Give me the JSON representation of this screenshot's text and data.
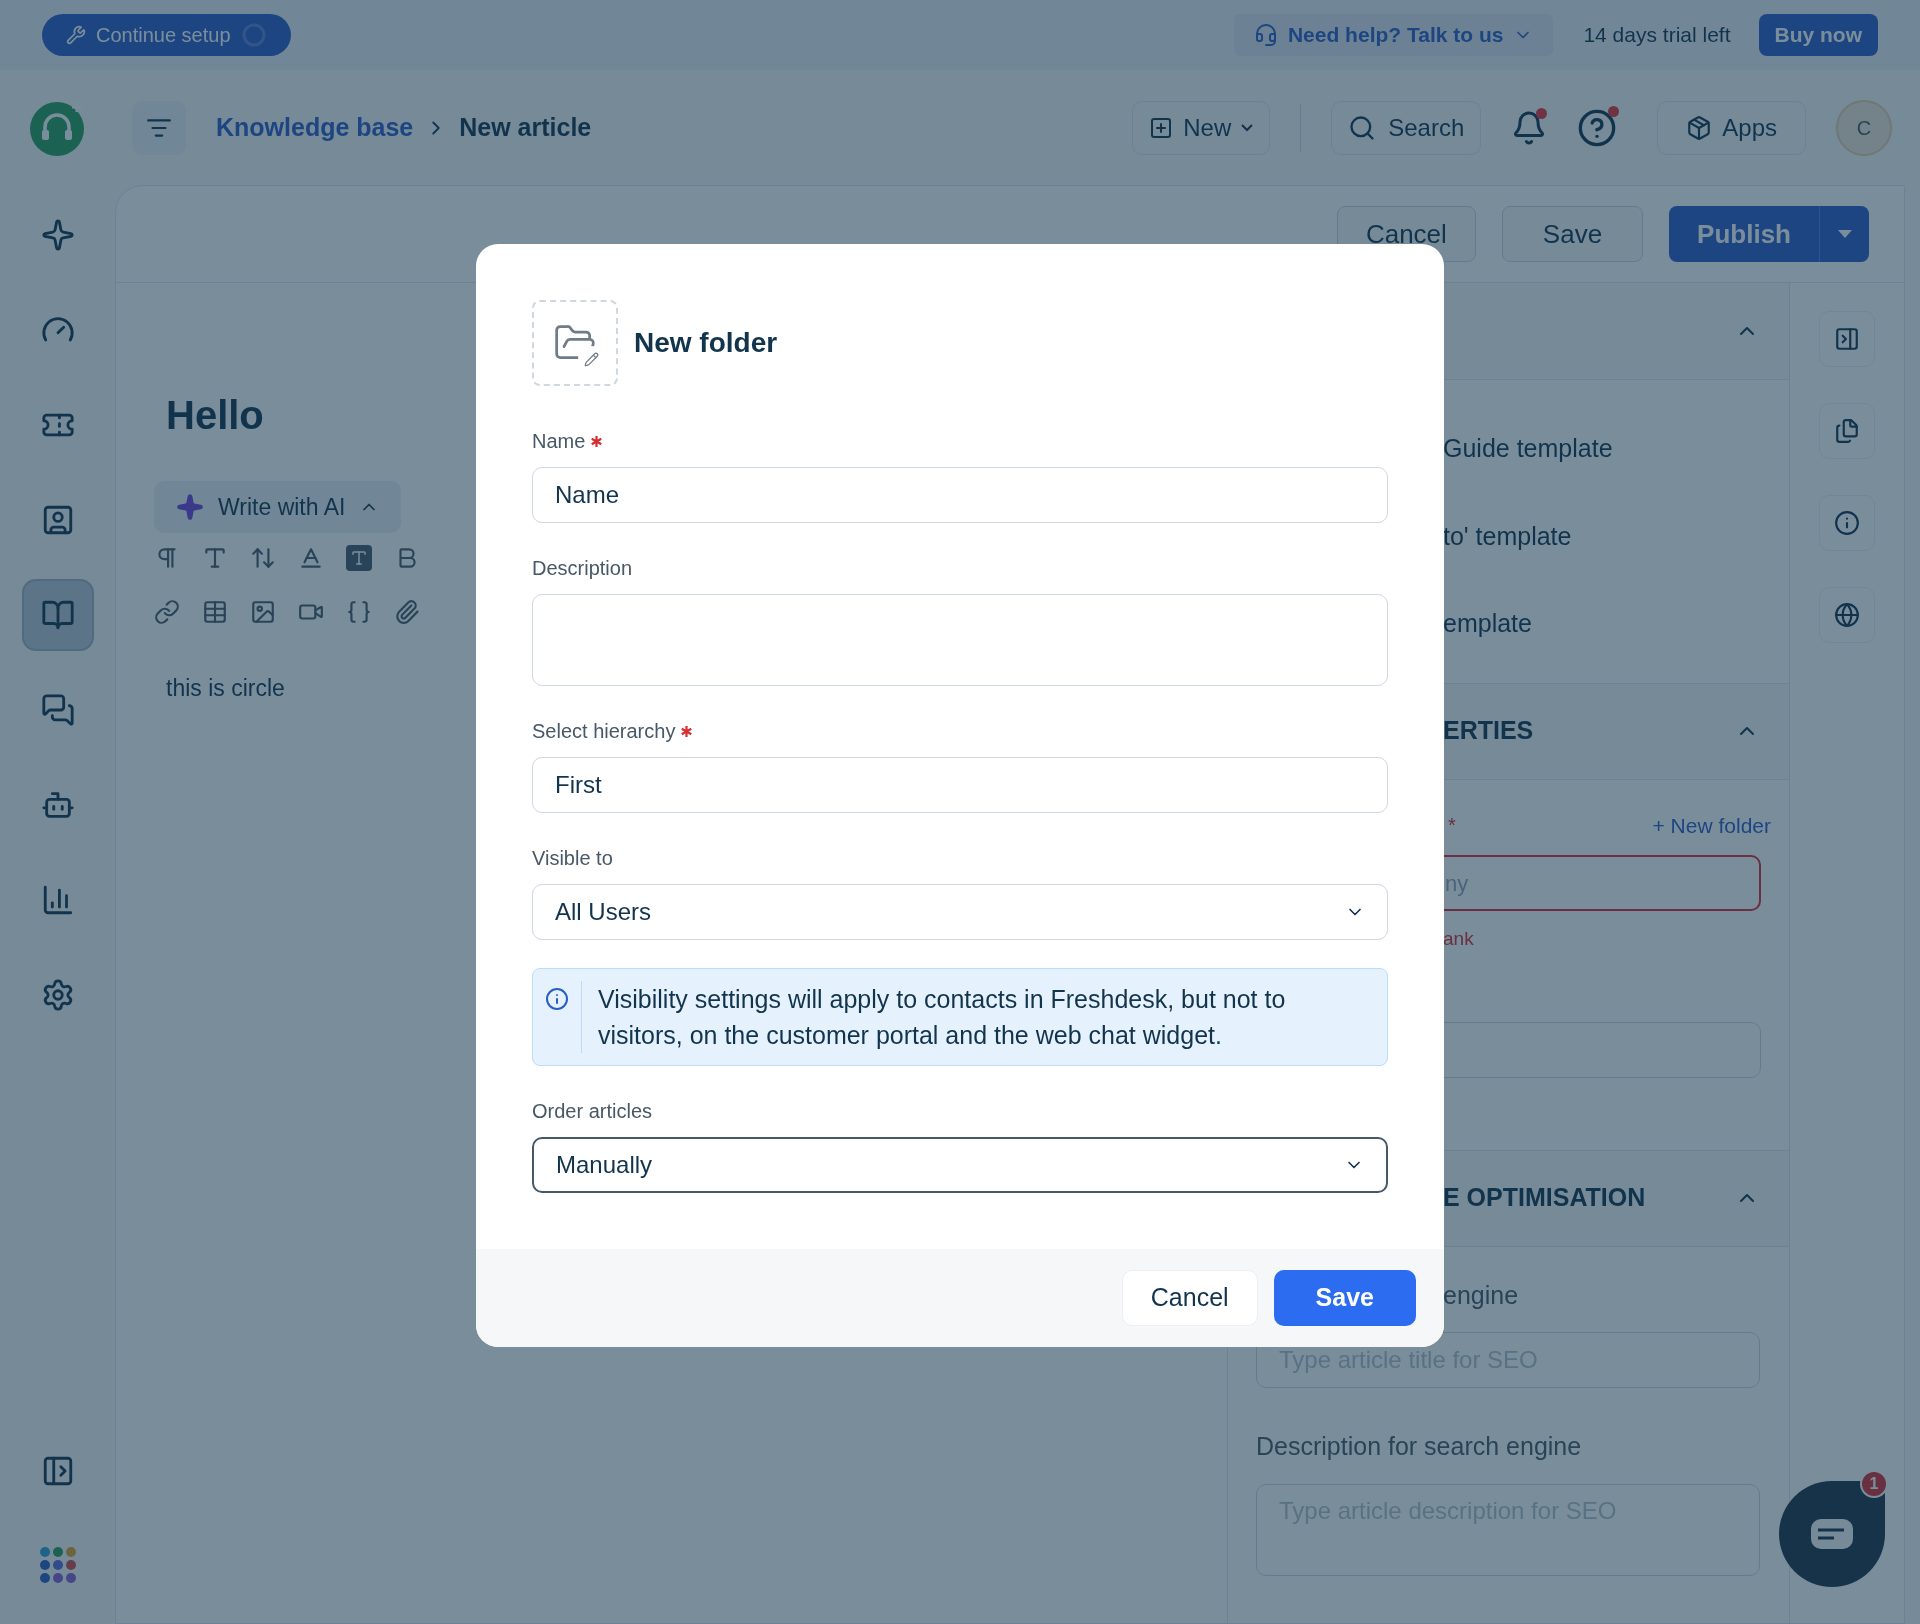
{
  "top_bar": {
    "setup_button": "Continue setup",
    "help_button": "Need help? Talk to us",
    "trial_text": "14 days trial left",
    "buy_button": "Buy now"
  },
  "header": {
    "breadcrumbs": [
      "Knowledge base",
      "New article"
    ],
    "new_button": "New",
    "search_button": "Search",
    "bell_dot": true,
    "help_dot": true,
    "apps_button": "Apps",
    "avatar": "C"
  },
  "sidebar": {
    "items": [
      {
        "selected": false
      },
      {
        "selected": false
      },
      {
        "selected": false
      },
      {
        "selected": false
      },
      {
        "selected": true
      },
      {
        "selected": false
      },
      {
        "selected": false
      },
      {
        "selected": false
      },
      {
        "selected": false
      }
    ]
  },
  "article_actions": {
    "cancel": "Cancel",
    "save": "Save",
    "publish": "Publish"
  },
  "editor": {
    "title": "Hello",
    "ai_button": "Write with AI",
    "body": "this is circle"
  },
  "right_panel": {
    "templates": [
      "Guide template",
      "to' template",
      "emplate"
    ],
    "properties": {
      "heading": "ERTIES",
      "required_mark": "*",
      "new_folder_link": "+ New folder",
      "hierarchy_placeholder": "ny",
      "error": "ank"
    },
    "seo": {
      "heading": "E OPTIMISATION",
      "title_label": "engine",
      "title_placeholder": "Type article title for SEO",
      "description_label": "Description for search engine",
      "description_placeholder": "Type article description for SEO"
    }
  },
  "chat_widget": {
    "badge": "1"
  },
  "modal": {
    "title": "New folder",
    "fields": [
      {
        "kind": "text",
        "label": "Name",
        "required": true,
        "value": "Name",
        "focused": false
      },
      {
        "kind": "textarea",
        "label": "Description",
        "required": false,
        "focused": false
      },
      {
        "kind": "text",
        "label": "Select hierarchy",
        "required": true,
        "value": "First",
        "focused": false
      },
      {
        "kind": "select",
        "label": "Visible to",
        "required": false,
        "value": "All Users",
        "focused": false
      },
      {
        "kind": "info",
        "text": "Visibility settings will apply to contacts in Freshdesk, but not to visitors, on the customer portal and the web chat widget."
      },
      {
        "kind": "select",
        "label": "Order articles",
        "required": false,
        "value": "Manually",
        "focused": true
      }
    ],
    "buttons": [
      {
        "label": "Cancel",
        "kind": "secondary"
      },
      {
        "label": "Save",
        "kind": "primary"
      }
    ]
  }
}
